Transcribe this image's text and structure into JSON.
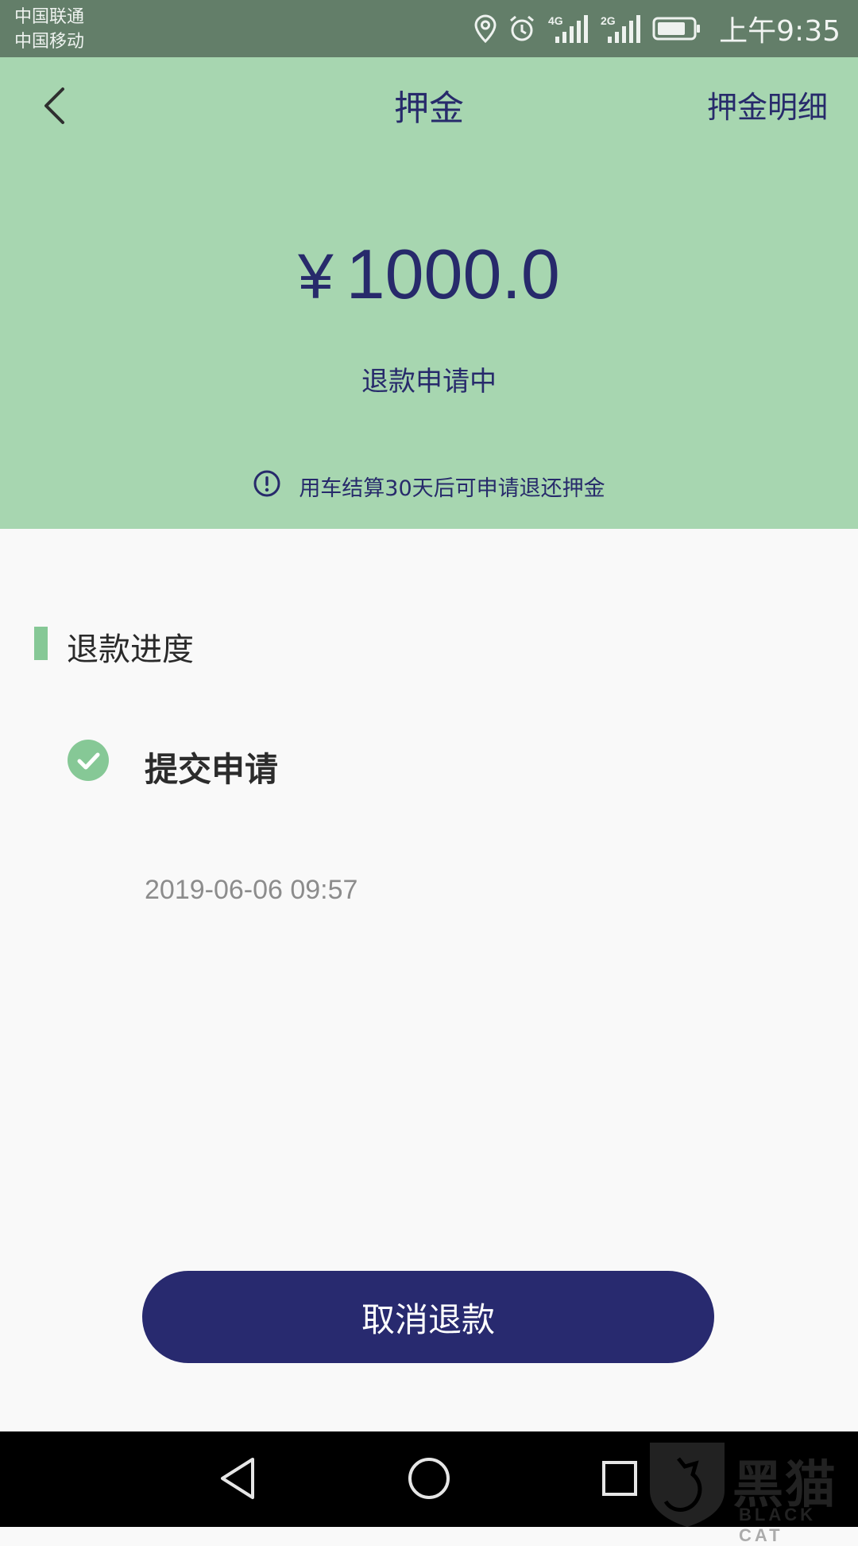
{
  "status_bar": {
    "carrier_1": "中国联通",
    "carrier_2": "中国移动",
    "icons": [
      "location-icon",
      "alarm-icon",
      "signal-4g-icon",
      "signal-2g-icon",
      "battery-icon"
    ],
    "signal_1_label": "4G",
    "signal_2_label": "2G",
    "time": "上午9:35"
  },
  "header": {
    "title": "押金",
    "detail_link": "押金明细",
    "currency": "¥",
    "amount": "1000.0",
    "status": "退款申请中",
    "notice": "用车结算30天后可申请退还押金"
  },
  "progress": {
    "section_title": "退款进度",
    "steps": [
      {
        "title": "提交申请",
        "time": "2019-06-06 09:57",
        "done": true
      }
    ]
  },
  "actions": {
    "cancel_label": "取消退款"
  },
  "watermark": {
    "text": "黑猫",
    "sub": "BLACK CAT"
  },
  "colors": {
    "status_bar": "#637e69",
    "header_bg": "#a7d6b0",
    "primary": "#282a6f",
    "accent": "#86c896"
  }
}
